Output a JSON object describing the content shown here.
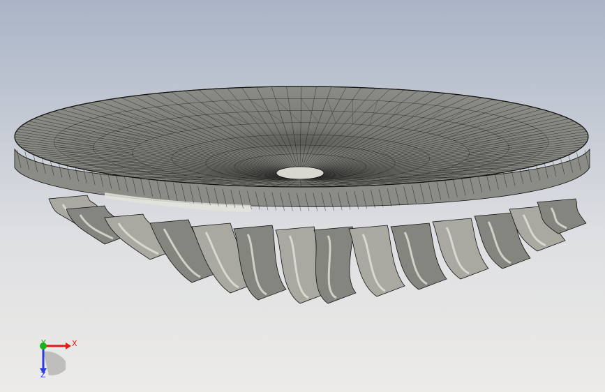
{
  "viewport": {
    "background_top": "#a9b4c6",
    "background_bottom": "#ecebe8"
  },
  "model": {
    "shell_color": "#85857f",
    "shell_light": "#a9a8a1",
    "highlight_color": "#e4e3dc",
    "edge_color": "#111111"
  },
  "triad": {
    "x_label": "X",
    "y_label": "Y",
    "z_label": "Z",
    "x_color": "#e01919",
    "y_color": "#18b418",
    "z_color": "#2a3cdc"
  }
}
